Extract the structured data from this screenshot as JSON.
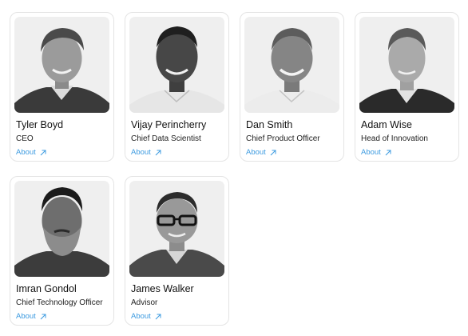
{
  "team": [
    {
      "name": "Tyler Boyd",
      "role": "CEO",
      "link": "About",
      "arrow_icon": "arrow-up-right-icon",
      "photo_icon": "portrait-photo"
    },
    {
      "name": "Vijay Perincherry",
      "role": "Chief Data Scientist",
      "link": "About",
      "arrow_icon": "arrow-up-right-icon",
      "photo_icon": "portrait-photo"
    },
    {
      "name": "Dan Smith",
      "role": "Chief Product Officer",
      "link": "About",
      "arrow_icon": "arrow-up-right-icon",
      "photo_icon": "portrait-photo"
    },
    {
      "name": "Adam Wise",
      "role": "Head of Innovation",
      "link": "About",
      "arrow_icon": "arrow-up-right-icon",
      "photo_icon": "portrait-photo"
    },
    {
      "name": "Imran Gondol",
      "role": "Chief Technology Officer",
      "link": "About",
      "arrow_icon": "arrow-up-right-icon",
      "photo_icon": "portrait-photo"
    },
    {
      "name": "James Walker",
      "role": "Advisor",
      "link": "About",
      "arrow_icon": "arrow-up-right-icon",
      "photo_icon": "portrait-photo"
    }
  ],
  "colors": {
    "link": "#3d9be0",
    "card_border": "#e4e4e4",
    "photo_background": "#efefef"
  }
}
